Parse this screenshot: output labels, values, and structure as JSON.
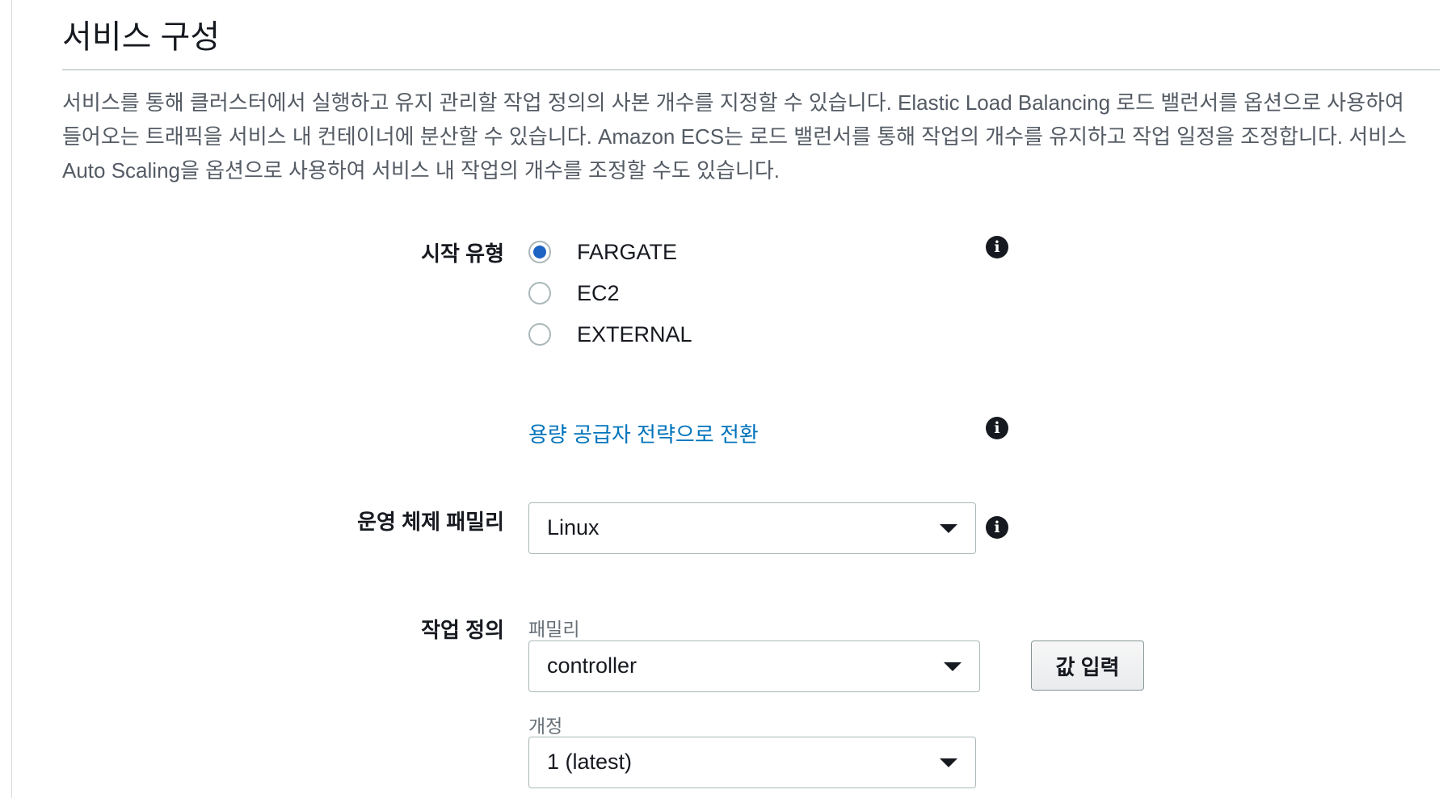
{
  "section": {
    "title": "서비스 구성",
    "description": "서비스를 통해 클러스터에서 실행하고 유지 관리할 작업 정의의 사본 개수를 지정할 수 있습니다. Elastic Load Balancing 로드 밸런서를 옵션으로 사용하여 들어오는 트래픽을 서비스 내 컨테이너에 분산할 수 있습니다. Amazon ECS는 로드 밸런서를 통해 작업의 개수를 유지하고 작업 일정을 조정합니다. 서비스 Auto Scaling을 옵션으로 사용하여 서비스 내 작업의 개수를 조정할 수도 있습니다."
  },
  "launch_type": {
    "label": "시작 유형",
    "options": [
      {
        "label": "FARGATE",
        "selected": true
      },
      {
        "label": "EC2",
        "selected": false
      },
      {
        "label": "EXTERNAL",
        "selected": false
      }
    ],
    "switch_link": "용량 공급자 전략으로 전환"
  },
  "os_family": {
    "label": "운영 체제 패밀리",
    "value": "Linux"
  },
  "task_definition": {
    "label": "작업 정의",
    "family_label": "패밀리",
    "family_value": "controller",
    "revision_label": "개정",
    "revision_value": "1 (latest)",
    "enter_value_button": "값 입력"
  },
  "icons": {
    "info": "info-icon",
    "dropdown": "caret-down-icon"
  },
  "colors": {
    "accent": "#1d64c4",
    "link": "#0073bb"
  }
}
